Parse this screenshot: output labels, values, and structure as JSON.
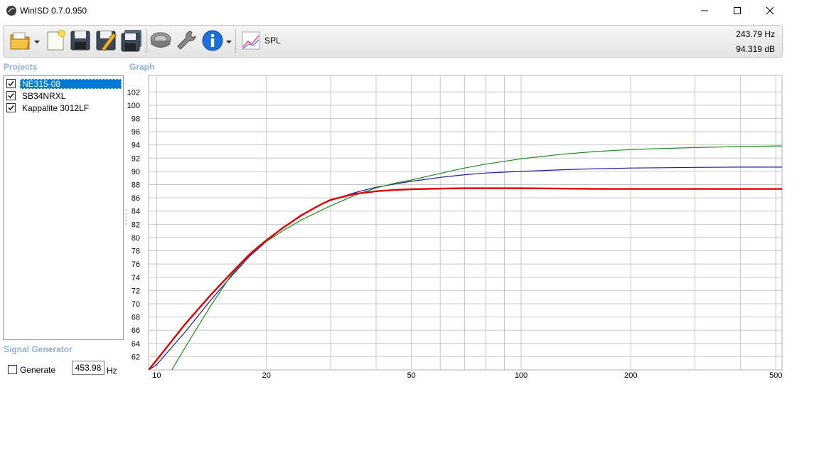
{
  "window": {
    "title": "WinISD 0.7.0.950",
    "minimize_icon": "minimize-icon",
    "maximize_icon": "maximize-icon",
    "close_icon": "close-icon"
  },
  "toolbar": {
    "items": [
      "open-folder-icon",
      "new-document-icon",
      "save-icon",
      "save-as-icon",
      "save-all-icon",
      "driver-icon",
      "wrench-icon",
      "info-icon",
      "graph-icon"
    ],
    "spl_label": "SPL",
    "readout_freq": "243.79 Hz",
    "readout_db": "94.319 dB"
  },
  "projects": {
    "label": "Projects",
    "items": [
      {
        "name": "NE315-08",
        "checked": true,
        "selected": true
      },
      {
        "name": "SB34NRXL",
        "checked": true,
        "selected": false
      },
      {
        "name": "Kappalite 3012LF",
        "checked": true,
        "selected": false
      }
    ]
  },
  "graph": {
    "label": "Graph"
  },
  "signal_generator": {
    "label": "Signal Generator",
    "generate_label": "Generate",
    "generate_checked": false,
    "frequency_value": "453.98",
    "frequency_unit": "Hz"
  },
  "chart_data": {
    "type": "line",
    "x_scale": "log",
    "xlim": [
      9.5,
      520
    ],
    "ylim": [
      60,
      104.5
    ],
    "x_tick_labels": [
      "10",
      "20",
      "50",
      "100",
      "200",
      "500"
    ],
    "x_ticks": [
      10,
      20,
      50,
      100,
      200,
      500
    ],
    "x_minor_grid": [
      30,
      40,
      60,
      70,
      80,
      90,
      300,
      400
    ],
    "y_ticks": [
      62,
      64,
      66,
      68,
      70,
      72,
      74,
      76,
      78,
      80,
      82,
      84,
      86,
      88,
      90,
      92,
      94,
      96,
      98,
      100,
      102
    ],
    "grid": true,
    "colors": {
      "red": "#e00000",
      "blue": "#1a1aa8",
      "green": "#1e8c1e",
      "grid": "#c8c8c8"
    },
    "series": [
      {
        "color": "#e00000",
        "width": 2.4,
        "x": [
          9.5,
          10,
          12,
          14,
          16,
          18,
          20,
          22,
          25,
          28,
          30,
          35,
          40,
          45,
          50,
          60,
          70,
          80,
          100,
          130,
          160,
          200,
          300,
          400,
          520
        ],
        "y": [
          60,
          61.5,
          67.0,
          71.2,
          74.6,
          77.5,
          79.6,
          81.3,
          83.4,
          84.9,
          85.7,
          86.6,
          87.0,
          87.2,
          87.3,
          87.4,
          87.45,
          87.45,
          87.45,
          87.4,
          87.35,
          87.35,
          87.35,
          87.35,
          87.35
        ]
      },
      {
        "color": "#1a1aa8",
        "width": 1.2,
        "x": [
          9.5,
          10,
          12,
          14,
          16,
          18,
          20,
          22,
          25,
          28,
          30,
          35,
          40,
          45,
          50,
          60,
          70,
          80,
          100,
          130,
          160,
          200,
          300,
          400,
          520
        ],
        "y": [
          60,
          60.8,
          65.8,
          70.4,
          74.1,
          77.2,
          79.4,
          81.3,
          83.3,
          84.9,
          85.6,
          86.8,
          87.6,
          88.1,
          88.5,
          89.1,
          89.5,
          89.75,
          90.0,
          90.25,
          90.4,
          90.5,
          90.6,
          90.65,
          90.65
        ]
      },
      {
        "color": "#1e8c1e",
        "width": 1.2,
        "x": [
          11,
          12,
          14,
          16,
          18,
          20,
          22,
          25,
          28,
          30,
          35,
          40,
          45,
          50,
          60,
          70,
          80,
          100,
          130,
          160,
          200,
          300,
          400,
          520
        ],
        "y": [
          60,
          63.5,
          69.5,
          74.3,
          77.4,
          79.4,
          80.9,
          82.7,
          84.0,
          84.8,
          86.4,
          87.5,
          88.2,
          88.7,
          89.7,
          90.5,
          91.1,
          91.9,
          92.6,
          93.0,
          93.3,
          93.6,
          93.75,
          93.85
        ]
      }
    ]
  }
}
